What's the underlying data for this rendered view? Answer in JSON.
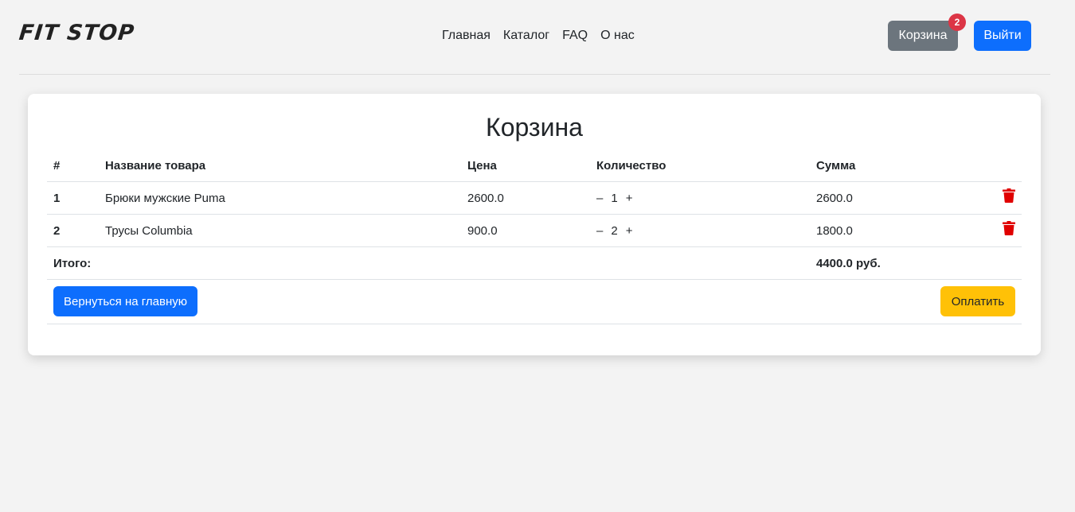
{
  "header": {
    "logo": "FIT STOP",
    "nav": [
      "Главная",
      "Каталог",
      "FAQ",
      "О нас"
    ],
    "cart_label": "Корзина",
    "cart_count": "2",
    "logout_label": "Выйти"
  },
  "cart": {
    "title": "Корзина",
    "columns": [
      "#",
      "Название товара",
      "Цена",
      "Количество",
      "Сумма"
    ],
    "items": [
      {
        "num": "1",
        "name": "Брюки мужские Puma",
        "price": "2600.0",
        "minus": "–",
        "qty": "1",
        "plus": "+",
        "sum": "2600.0"
      },
      {
        "num": "2",
        "name": "Трусы Columbia",
        "price": "900.0",
        "minus": "–",
        "qty": "2",
        "plus": "+",
        "sum": "1800.0"
      }
    ],
    "total_label": "Итого:",
    "total_value": "4400.0 руб.",
    "back_label": "Вернуться на главную",
    "pay_label": "Оплатить"
  },
  "colors": {
    "primary": "#0d6efd",
    "secondary": "#6c757d",
    "warning": "#ffc107",
    "danger": "#dc3545",
    "trash": "#e00000"
  },
  "icons": {
    "delete": "trash-icon"
  }
}
